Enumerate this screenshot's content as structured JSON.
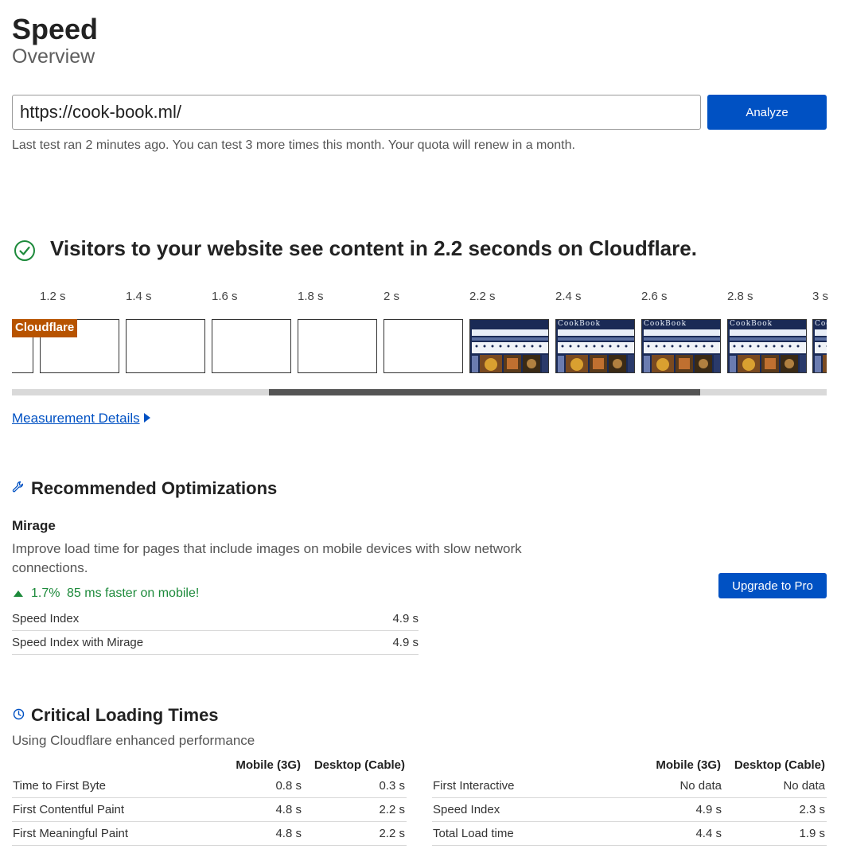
{
  "header": {
    "title": "Speed",
    "subtitle": "Overview"
  },
  "search": {
    "url_value": "https://cook-book.ml/",
    "analyze_label": "Analyze",
    "quota_text": "Last test ran 2 minutes ago. You can test 3 more times this month. Your quota will renew in a month."
  },
  "result": {
    "headline": "Visitors to your website see content in 2.2 seconds on Cloudflare.",
    "status_icon": "check-circle-icon",
    "status_color": "#1d8a3b"
  },
  "filmstrip": {
    "badge": "Cloudflare",
    "badge_color": "#b75300",
    "ticks": [
      "1.2 s",
      "1.4 s",
      "1.6 s",
      "1.8 s",
      "2 s",
      "2.2 s",
      "2.4 s",
      "2.6 s",
      "2.8 s",
      "3 s"
    ],
    "frame_brand": "CookBook",
    "scroll_position": 0.315,
    "scroll_visible_fraction": 0.53
  },
  "measurement_link": "Measurement Details",
  "optimizations": {
    "heading": "Recommended Optimizations",
    "icon": "wrench-icon",
    "item_title": "Mirage",
    "item_description": "Improve load time for pages that include images on mobile devices with slow network connections.",
    "gain_percent": "1.7%",
    "gain_text": "85 ms faster on mobile!",
    "upgrade_label": "Upgrade to Pro",
    "rows": [
      {
        "label": "Speed Index",
        "value": "4.9 s"
      },
      {
        "label": "Speed Index with Mirage",
        "value": "4.9 s"
      }
    ]
  },
  "critical": {
    "heading": "Critical Loading Times",
    "icon": "clock-icon",
    "subtitle": "Using Cloudflare enhanced performance",
    "col_mobile": "Mobile (3G)",
    "col_desktop": "Desktop (Cable)",
    "left_rows": [
      {
        "label": "Time to First Byte",
        "mobile": "0.8 s",
        "desktop": "0.3 s"
      },
      {
        "label": "First Contentful Paint",
        "mobile": "4.8 s",
        "desktop": "2.2 s"
      },
      {
        "label": "First Meaningful Paint",
        "mobile": "4.8 s",
        "desktop": "2.2 s"
      }
    ],
    "right_rows": [
      {
        "label": "First Interactive",
        "mobile": "No data",
        "desktop": "No data"
      },
      {
        "label": "Speed Index",
        "mobile": "4.9 s",
        "desktop": "2.3 s"
      },
      {
        "label": "Total Load time",
        "mobile": "4.4 s",
        "desktop": "1.9 s"
      }
    ]
  },
  "colors": {
    "primary": "#0051c3",
    "link": "#0051c3",
    "success": "#1d8a3b",
    "frame_dark": "#1a2a55"
  }
}
